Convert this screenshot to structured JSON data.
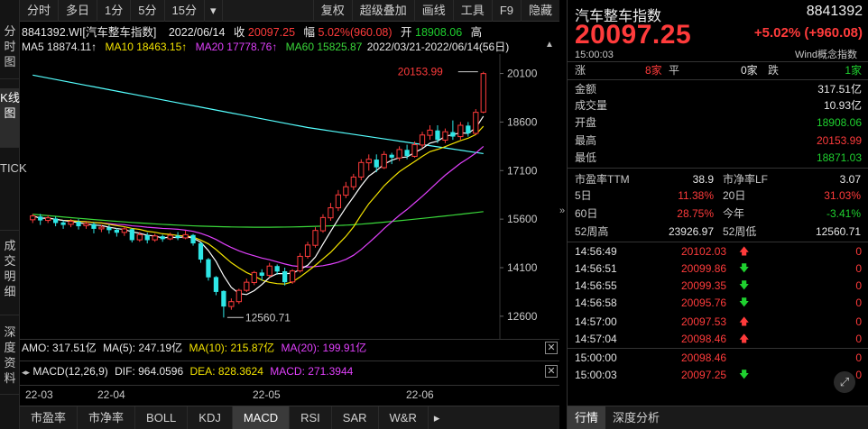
{
  "vtabs": [
    "分时图",
    "K线图",
    "TICK",
    "成交明细",
    "深度资料"
  ],
  "toolbar": {
    "left": [
      "分时",
      "多日",
      "1分",
      "5分",
      "15分"
    ],
    "right": [
      "复权",
      "超级叠加",
      "画线",
      "工具",
      "F9",
      "隐藏"
    ]
  },
  "header": {
    "code_name": "8841392.WI[汽车整车指数]",
    "date": "2022/06/14",
    "close_label": "收",
    "close": "20097.25",
    "amp_label": "幅",
    "amp": "5.02%(960.08)",
    "open_label": "开",
    "open": "18908.06",
    "high_label": "高"
  },
  "ma": {
    "ma5": "MA5 18874.11↑",
    "ma10": "MA10 18463.15↑",
    "ma20": "MA20 17778.76↑",
    "ma60": "MA60 15825.87",
    "range": "2022/03/21-2022/06/14(56日)"
  },
  "price_axis": [
    "20100",
    "18600",
    "17100",
    "15600",
    "14100",
    "12600"
  ],
  "annotations": {
    "high": "20153.99",
    "low": "12560.71"
  },
  "indicator1": {
    "amo": "AMO: 317.51亿",
    "ma5": "MA(5): 247.19亿",
    "ma10": "MA(10): 215.87亿",
    "ma20": "MA(20): 199.91亿"
  },
  "indicator2": {
    "name": "MACD(12,26,9)",
    "dif": "DIF: 964.0596",
    "dea": "DEA: 828.3624",
    "macd": "MACD: 271.3944"
  },
  "x_axis": [
    "22-03",
    "22-04",
    "22-05",
    "22-06"
  ],
  "bottom_tabs": [
    "市盈率",
    "市净率",
    "BOLL",
    "KDJ",
    "MACD",
    "RSI",
    "SAR",
    "W&R"
  ],
  "active_bottom_tab": "MACD",
  "colors": {
    "up": "#ff3b3b",
    "down": "#1fd12f",
    "ma5": "#ffffff",
    "ma10": "#f2e200",
    "ma20": "#e040fb",
    "ma60": "#3ad83a",
    "cyan": "#55ffff"
  },
  "quote": {
    "name": "汽车整车指数",
    "code": "8841392",
    "price": "20097.25",
    "change": "+5.02% (+960.08)",
    "time": "15:00:03",
    "wind": "Wind概念指数",
    "breadth": {
      "up_label": "涨",
      "up": "8家",
      "flat_label": "平",
      "flat": "0家",
      "down_label": "跌",
      "down": "1家"
    },
    "stats": [
      {
        "label": "金额",
        "value": "317.51亿",
        "color": "white"
      },
      {
        "label": "成交量",
        "value": "10.93亿",
        "color": "white"
      },
      {
        "label": "开盘",
        "value": "18908.06",
        "color": "green"
      },
      {
        "label": "最高",
        "value": "20153.99",
        "color": "red"
      },
      {
        "label": "最低",
        "value": "18871.03",
        "color": "green"
      }
    ],
    "pe_label": "市盈率TTM",
    "pe": "38.9",
    "pb_label": "市净率LF",
    "pb": "3.07",
    "d5_label": "5日",
    "d5": "11.38%",
    "d20_label": "20日",
    "d20": "31.03%",
    "d60_label": "60日",
    "d60": "28.75%",
    "ytd_label": "今年",
    "ytd": "-3.41%",
    "w52h_label": "52周高",
    "w52h": "23926.97",
    "w52l_label": "52周低",
    "w52l": "12560.71",
    "ticks": [
      {
        "t": "14:56:49",
        "p": "20102.03",
        "dir": "up",
        "v": "0"
      },
      {
        "t": "14:56:51",
        "p": "20099.86",
        "dir": "down",
        "v": "0"
      },
      {
        "t": "14:56:55",
        "p": "20099.35",
        "dir": "down",
        "v": "0"
      },
      {
        "t": "14:56:58",
        "p": "20095.76",
        "dir": "down",
        "v": "0"
      },
      {
        "t": "14:57:00",
        "p": "20097.53",
        "dir": "up",
        "v": "0"
      },
      {
        "t": "14:57:04",
        "p": "20098.46",
        "dir": "up",
        "v": "0"
      },
      {
        "t": "15:00:00",
        "p": "20098.46",
        "dir": "",
        "v": "0"
      },
      {
        "t": "15:00:03",
        "p": "20097.25",
        "dir": "down",
        "v": "0"
      }
    ],
    "tabs": [
      "行情",
      "深度分析"
    ]
  },
  "chart_data": {
    "type": "candlestick",
    "ylim": [
      11900,
      20700
    ],
    "candles": [
      [
        15580,
        15700,
        15480,
        15760
      ],
      [
        15680,
        15560,
        15420,
        15760
      ],
      [
        15560,
        15640,
        15480,
        15720
      ],
      [
        15620,
        15480,
        15380,
        15680
      ],
      [
        15500,
        15420,
        15300,
        15560
      ],
      [
        15440,
        15530,
        15350,
        15600
      ],
      [
        15520,
        15380,
        15280,
        15600
      ],
      [
        15400,
        15460,
        15300,
        15520
      ],
      [
        15450,
        15300,
        15160,
        15500
      ],
      [
        15300,
        15350,
        15200,
        15420
      ],
      [
        15340,
        15260,
        15150,
        15420
      ],
      [
        15270,
        15180,
        15060,
        15320
      ],
      [
        15190,
        15300,
        15080,
        15360
      ],
      [
        15290,
        14950,
        14880,
        15320
      ],
      [
        14960,
        15120,
        14900,
        15200
      ],
      [
        15100,
        14950,
        14850,
        15180
      ],
      [
        14960,
        15080,
        14900,
        15150
      ],
      [
        15070,
        14980,
        14900,
        15120
      ],
      [
        14990,
        15100,
        14950,
        15180
      ],
      [
        15090,
        15020,
        14950,
        15200
      ],
      [
        15020,
        15120,
        14980,
        15250
      ],
      [
        15110,
        14850,
        14780,
        15140
      ],
      [
        14860,
        14350,
        14250,
        14880
      ],
      [
        14360,
        13800,
        13700,
        14400
      ],
      [
        13810,
        13350,
        13250,
        13840
      ],
      [
        13380,
        12900,
        12560,
        13400
      ],
      [
        12900,
        13050,
        12800,
        13150
      ],
      [
        13050,
        13400,
        12980,
        13450
      ],
      [
        13400,
        13650,
        13350,
        13760
      ],
      [
        13640,
        13950,
        13560,
        14000
      ],
      [
        13950,
        13850,
        13700,
        14050
      ],
      [
        13860,
        14150,
        13800,
        14250
      ],
      [
        14150,
        13980,
        13880,
        14200
      ],
      [
        13990,
        13650,
        13550,
        14100
      ],
      [
        13660,
        14000,
        13600,
        14050
      ],
      [
        14000,
        14450,
        13950,
        14550
      ],
      [
        14450,
        14800,
        14380,
        14900
      ],
      [
        14790,
        15250,
        14720,
        15350
      ],
      [
        15240,
        15650,
        15180,
        15750
      ],
      [
        15640,
        15950,
        15550,
        16100
      ],
      [
        15950,
        16350,
        15850,
        16500
      ],
      [
        16340,
        16600,
        16250,
        16750
      ],
      [
        16600,
        16900,
        16500,
        17000
      ],
      [
        16900,
        17350,
        16800,
        17450
      ],
      [
        17340,
        17450,
        17100,
        17600
      ],
      [
        17440,
        17200,
        17050,
        17600
      ],
      [
        17190,
        17600,
        17150,
        17700
      ],
      [
        17590,
        17500,
        17300,
        17650
      ],
      [
        17490,
        17750,
        17400,
        17850
      ],
      [
        17740,
        17550,
        17450,
        17900
      ],
      [
        17540,
        17900,
        17500,
        18000
      ],
      [
        17890,
        18200,
        17800,
        18300
      ],
      [
        18190,
        18350,
        18050,
        18500
      ],
      [
        18340,
        18050,
        17950,
        18500
      ],
      [
        18040,
        18300,
        17950,
        18400
      ],
      [
        18290,
        18150,
        18050,
        18650
      ],
      [
        18150,
        18500,
        18050,
        18600
      ],
      [
        18490,
        18250,
        18150,
        18600
      ],
      [
        18250,
        18900,
        18200,
        19000
      ],
      [
        18908,
        20097,
        18871,
        20154
      ]
    ]
  }
}
